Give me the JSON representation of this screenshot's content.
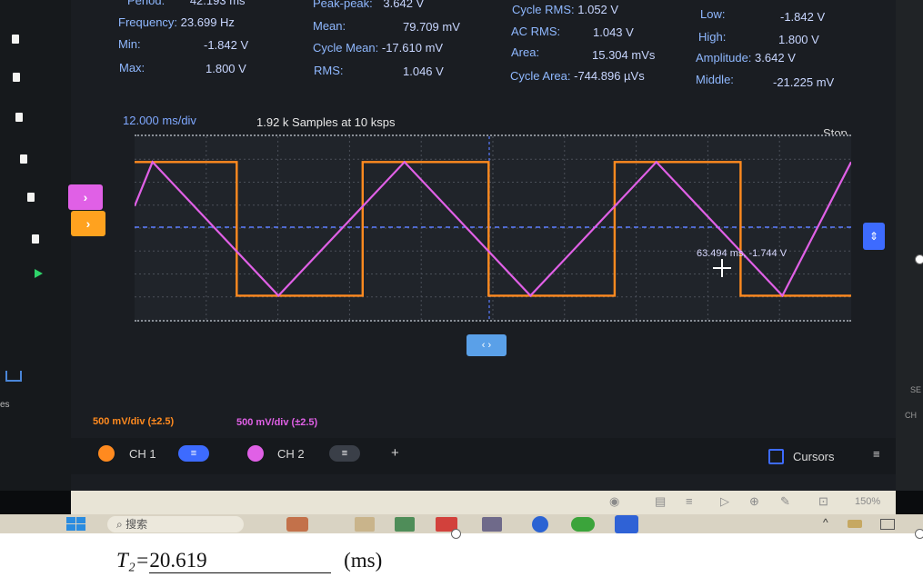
{
  "measurements": {
    "period": {
      "label": "Period:",
      "value": "42.193 ms"
    },
    "frequency": {
      "label": "Frequency:",
      "value": "23.699 Hz"
    },
    "min": {
      "label": "Min:",
      "value": "-1.842 V"
    },
    "max": {
      "label": "Max:",
      "value": "1.800 V"
    },
    "peak_peak": {
      "label": "Peak-peak:",
      "value": "3.642 V"
    },
    "mean": {
      "label": "Mean:",
      "value": "79.709 mV"
    },
    "cycle_mean": {
      "label": "Cycle Mean:",
      "value": "-17.610 mV"
    },
    "rms": {
      "label": "RMS:",
      "value": "1.046 V"
    },
    "cycle_rms": {
      "label": "Cycle RMS:",
      "value": "1.052 V"
    },
    "ac_rms": {
      "label": "AC RMS:",
      "value": "1.043 V"
    },
    "area": {
      "label": "Area:",
      "value": "15.304 mVs"
    },
    "cycle_area": {
      "label": "Cycle Area:",
      "value": "-744.896 µVs"
    },
    "low": {
      "label": "Low:",
      "value": "-1.842 V"
    },
    "high": {
      "label": "High:",
      "value": "1.800 V"
    },
    "amplitude": {
      "label": "Amplitude:",
      "value": "3.642 V"
    },
    "middle": {
      "label": "Middle:",
      "value": "-21.225 mV"
    }
  },
  "scope": {
    "timebase": "12.000 ms/div",
    "samples": "1.92 k Samples at 10 ksps",
    "status": "Stop",
    "cursor_readout": "63.494 ms, -1.744 V",
    "ch1_scale": "500 mV/div (±2.5)",
    "ch2_scale": "500 mV/div (±2.5)"
  },
  "channels": {
    "ch1": {
      "label": "CH 1",
      "color": "#ff8a1f",
      "marker_glyph": "›"
    },
    "ch2": {
      "label": "CH 2",
      "color": "#e060e6",
      "marker_glyph": "›"
    }
  },
  "cursors": {
    "label": "Cursors"
  },
  "zoom": "150%",
  "taskbar": {
    "search_text": "搜索"
  },
  "side_labels": {
    "left": "es",
    "right_top": "SE",
    "right_bottom": "CH"
  },
  "chart_data": [
    {
      "type": "line",
      "series": [
        {
          "name": "CH 1",
          "color": "#ff8a1f",
          "wave": "square",
          "period_ms": 42.193,
          "high_v": 1.8,
          "low_v": -1.842
        },
        {
          "name": "CH 2",
          "color": "#e060e6",
          "wave": "triangle",
          "period_ms": 42.193,
          "high_v": 1.8,
          "low_v": -1.842
        }
      ],
      "xlabel": "12.000 ms/div",
      "ylabel": "500 mV/div"
    }
  ],
  "footer": {
    "label": "T₂=",
    "value": "20.619",
    "unit": "(ms)"
  }
}
